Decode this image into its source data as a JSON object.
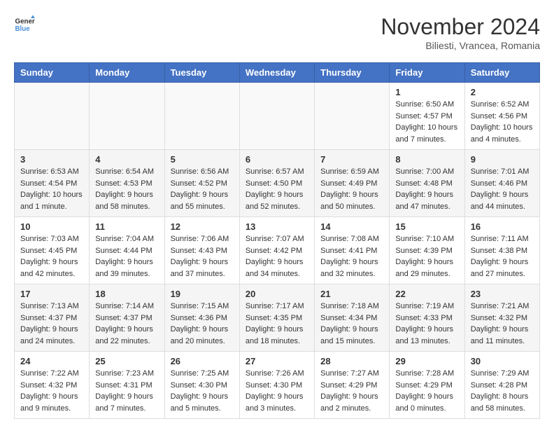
{
  "logo": {
    "text_general": "General",
    "text_blue": "Blue"
  },
  "title": "November 2024",
  "subtitle": "Biliesti, Vrancea, Romania",
  "days_of_week": [
    "Sunday",
    "Monday",
    "Tuesday",
    "Wednesday",
    "Thursday",
    "Friday",
    "Saturday"
  ],
  "weeks": [
    [
      {
        "day": "",
        "info": ""
      },
      {
        "day": "",
        "info": ""
      },
      {
        "day": "",
        "info": ""
      },
      {
        "day": "",
        "info": ""
      },
      {
        "day": "",
        "info": ""
      },
      {
        "day": "1",
        "info": "Sunrise: 6:50 AM\nSunset: 4:57 PM\nDaylight: 10 hours and 7 minutes."
      },
      {
        "day": "2",
        "info": "Sunrise: 6:52 AM\nSunset: 4:56 PM\nDaylight: 10 hours and 4 minutes."
      }
    ],
    [
      {
        "day": "3",
        "info": "Sunrise: 6:53 AM\nSunset: 4:54 PM\nDaylight: 10 hours and 1 minute."
      },
      {
        "day": "4",
        "info": "Sunrise: 6:54 AM\nSunset: 4:53 PM\nDaylight: 9 hours and 58 minutes."
      },
      {
        "day": "5",
        "info": "Sunrise: 6:56 AM\nSunset: 4:52 PM\nDaylight: 9 hours and 55 minutes."
      },
      {
        "day": "6",
        "info": "Sunrise: 6:57 AM\nSunset: 4:50 PM\nDaylight: 9 hours and 52 minutes."
      },
      {
        "day": "7",
        "info": "Sunrise: 6:59 AM\nSunset: 4:49 PM\nDaylight: 9 hours and 50 minutes."
      },
      {
        "day": "8",
        "info": "Sunrise: 7:00 AM\nSunset: 4:48 PM\nDaylight: 9 hours and 47 minutes."
      },
      {
        "day": "9",
        "info": "Sunrise: 7:01 AM\nSunset: 4:46 PM\nDaylight: 9 hours and 44 minutes."
      }
    ],
    [
      {
        "day": "10",
        "info": "Sunrise: 7:03 AM\nSunset: 4:45 PM\nDaylight: 9 hours and 42 minutes."
      },
      {
        "day": "11",
        "info": "Sunrise: 7:04 AM\nSunset: 4:44 PM\nDaylight: 9 hours and 39 minutes."
      },
      {
        "day": "12",
        "info": "Sunrise: 7:06 AM\nSunset: 4:43 PM\nDaylight: 9 hours and 37 minutes."
      },
      {
        "day": "13",
        "info": "Sunrise: 7:07 AM\nSunset: 4:42 PM\nDaylight: 9 hours and 34 minutes."
      },
      {
        "day": "14",
        "info": "Sunrise: 7:08 AM\nSunset: 4:41 PM\nDaylight: 9 hours and 32 minutes."
      },
      {
        "day": "15",
        "info": "Sunrise: 7:10 AM\nSunset: 4:39 PM\nDaylight: 9 hours and 29 minutes."
      },
      {
        "day": "16",
        "info": "Sunrise: 7:11 AM\nSunset: 4:38 PM\nDaylight: 9 hours and 27 minutes."
      }
    ],
    [
      {
        "day": "17",
        "info": "Sunrise: 7:13 AM\nSunset: 4:37 PM\nDaylight: 9 hours and 24 minutes."
      },
      {
        "day": "18",
        "info": "Sunrise: 7:14 AM\nSunset: 4:37 PM\nDaylight: 9 hours and 22 minutes."
      },
      {
        "day": "19",
        "info": "Sunrise: 7:15 AM\nSunset: 4:36 PM\nDaylight: 9 hours and 20 minutes."
      },
      {
        "day": "20",
        "info": "Sunrise: 7:17 AM\nSunset: 4:35 PM\nDaylight: 9 hours and 18 minutes."
      },
      {
        "day": "21",
        "info": "Sunrise: 7:18 AM\nSunset: 4:34 PM\nDaylight: 9 hours and 15 minutes."
      },
      {
        "day": "22",
        "info": "Sunrise: 7:19 AM\nSunset: 4:33 PM\nDaylight: 9 hours and 13 minutes."
      },
      {
        "day": "23",
        "info": "Sunrise: 7:21 AM\nSunset: 4:32 PM\nDaylight: 9 hours and 11 minutes."
      }
    ],
    [
      {
        "day": "24",
        "info": "Sunrise: 7:22 AM\nSunset: 4:32 PM\nDaylight: 9 hours and 9 minutes."
      },
      {
        "day": "25",
        "info": "Sunrise: 7:23 AM\nSunset: 4:31 PM\nDaylight: 9 hours and 7 minutes."
      },
      {
        "day": "26",
        "info": "Sunrise: 7:25 AM\nSunset: 4:30 PM\nDaylight: 9 hours and 5 minutes."
      },
      {
        "day": "27",
        "info": "Sunrise: 7:26 AM\nSunset: 4:30 PM\nDaylight: 9 hours and 3 minutes."
      },
      {
        "day": "28",
        "info": "Sunrise: 7:27 AM\nSunset: 4:29 PM\nDaylight: 9 hours and 2 minutes."
      },
      {
        "day": "29",
        "info": "Sunrise: 7:28 AM\nSunset: 4:29 PM\nDaylight: 9 hours and 0 minutes."
      },
      {
        "day": "30",
        "info": "Sunrise: 7:29 AM\nSunset: 4:28 PM\nDaylight: 8 hours and 58 minutes."
      }
    ]
  ]
}
